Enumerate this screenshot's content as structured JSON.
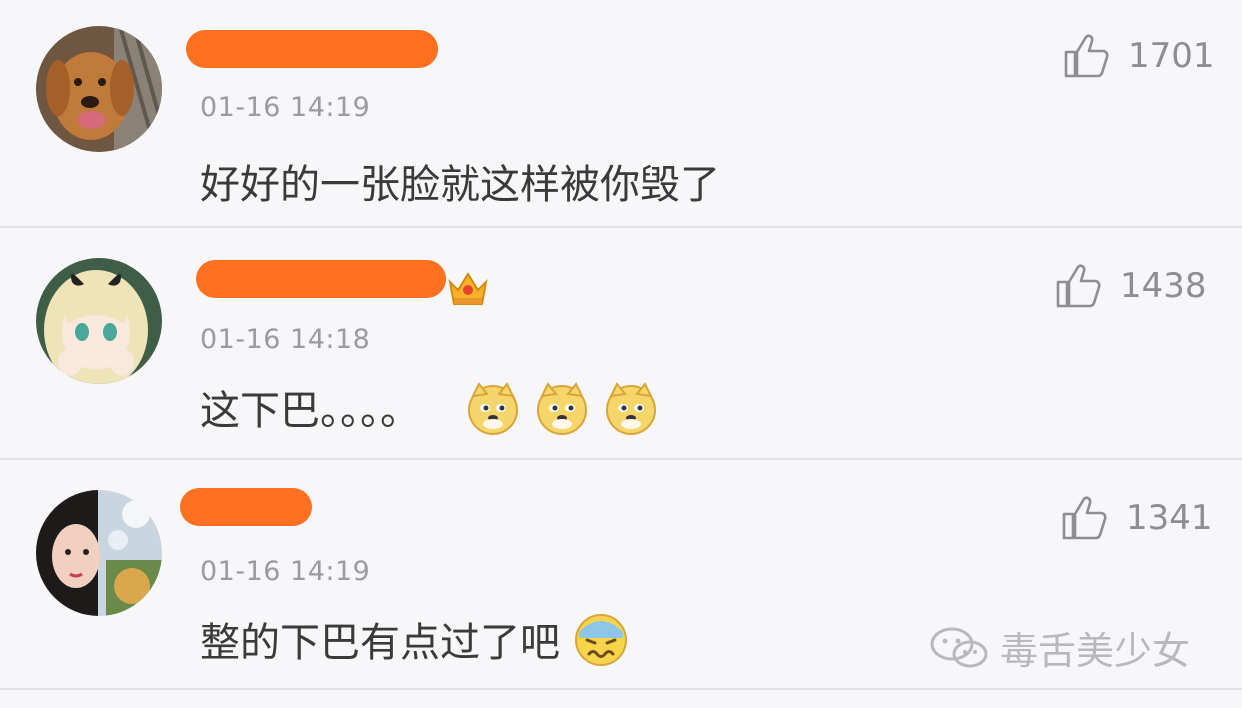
{
  "comments": [
    {
      "timestamp": "01-16 14:19",
      "text": "好好的一张脸就这样被你毁了",
      "likes": "1701",
      "avatar": "dog-avatar",
      "emojis": []
    },
    {
      "timestamp": "01-16 14:18",
      "text": "这下巴。。。。",
      "likes": "1438",
      "avatar": "anime-girl-avatar",
      "emojis": [
        "doge-emoji",
        "doge-emoji",
        "doge-emoji"
      ]
    },
    {
      "timestamp": "01-16 14:19",
      "text": "整的下巴有点过了吧",
      "likes": "1341",
      "avatar": "woman-avatar",
      "emojis": [
        "sweat-emoji"
      ]
    }
  ],
  "watermark": {
    "text": "毒舌美少女"
  },
  "colors": {
    "redact": "#ff7020",
    "text": "#3a3a3a",
    "meta": "#9a9aa0",
    "divider": "#e2e2e6",
    "background": "#f7f7f9"
  }
}
